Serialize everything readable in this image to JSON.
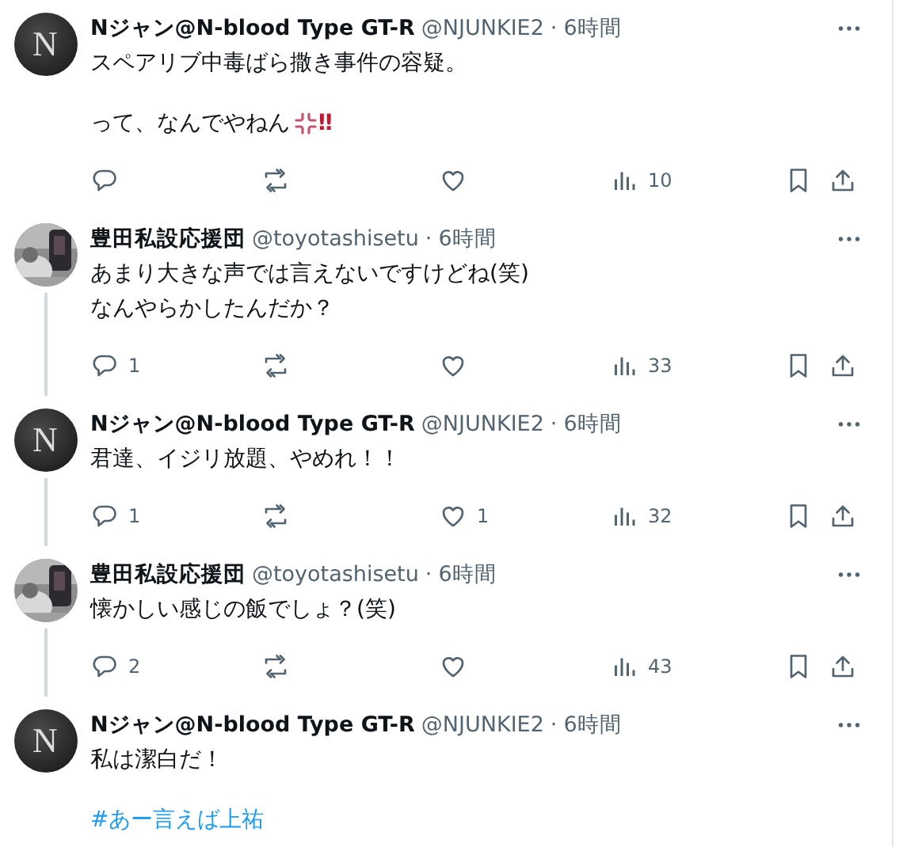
{
  "tweets": [
    {
      "author": "Nジャン@N-blood Type GT-R",
      "handle": "@NJUNKIE2",
      "separator": "·",
      "time": "6時間",
      "avatar": {
        "kind": "letter",
        "letter": "N"
      },
      "thread_line": false,
      "paragraphs": [
        {
          "kind": "text",
          "lines": [
            "スペアリブ中毒ばら撒き事件の容疑。"
          ]
        },
        {
          "kind": "text",
          "lines": [
            "って、なんでやねん"
          ],
          "anger_mark": true,
          "suffix": "‼"
        }
      ],
      "actions": {
        "views": "10"
      }
    },
    {
      "author": "豊田私設応援団",
      "handle": "@toyotashisetu",
      "separator": "·",
      "time": "6時間",
      "avatar": {
        "kind": "picture"
      },
      "thread_line": true,
      "paragraphs": [
        {
          "kind": "text",
          "lines": [
            "あまり大きな声では言えないですけどね(笑)",
            "なんやらかしたんだか？"
          ]
        }
      ],
      "actions": {
        "replies": "1",
        "views": "33"
      }
    },
    {
      "author": "Nジャン@N-blood Type GT-R",
      "handle": "@NJUNKIE2",
      "separator": "·",
      "time": "6時間",
      "avatar": {
        "kind": "letter",
        "letter": "N"
      },
      "thread_line": true,
      "paragraphs": [
        {
          "kind": "text",
          "lines": [
            "君達、イジリ放題、やめれ！！"
          ]
        }
      ],
      "actions": {
        "replies": "1",
        "likes": "1",
        "views": "32"
      }
    },
    {
      "author": "豊田私設応援団",
      "handle": "@toyotashisetu",
      "separator": "·",
      "time": "6時間",
      "avatar": {
        "kind": "picture"
      },
      "thread_line": true,
      "paragraphs": [
        {
          "kind": "text",
          "lines": [
            "懐かしい感じの飯でしょ？(笑)"
          ]
        }
      ],
      "actions": {
        "replies": "2",
        "views": "43"
      }
    },
    {
      "author": "Nジャン@N-blood Type GT-R",
      "handle": "@NJUNKIE2",
      "separator": "·",
      "time": "6時間",
      "avatar": {
        "kind": "letter",
        "letter": "N"
      },
      "thread_line": false,
      "paragraphs": [
        {
          "kind": "text",
          "lines": [
            "私は潔白だ！"
          ]
        },
        {
          "kind": "hashtag",
          "lines": [
            "#あー言えば上祐"
          ]
        }
      ]
    }
  ]
}
